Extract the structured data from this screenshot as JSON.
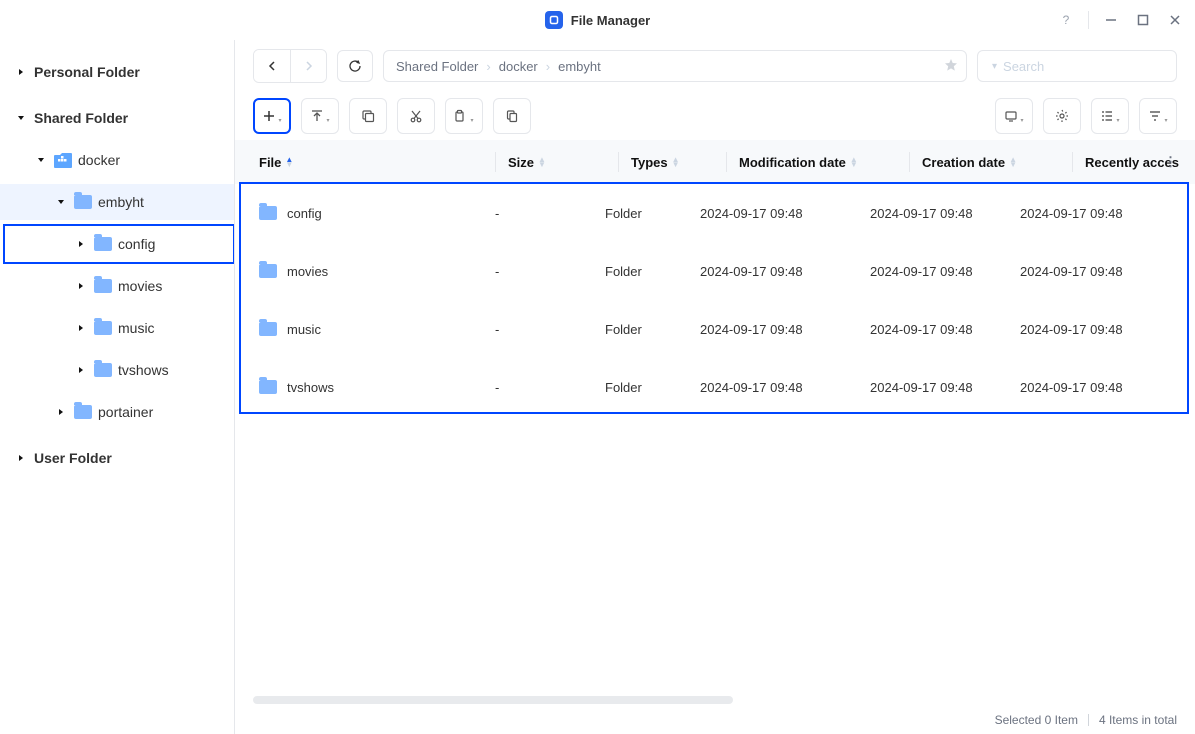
{
  "titlebar": {
    "title": "File Manager"
  },
  "sidebar": {
    "personal_label": "Personal Folder",
    "shared_label": "Shared Folder",
    "user_label": "User Folder",
    "docker_label": "docker",
    "embyht_label": "embyht",
    "config_label": "config",
    "movies_label": "movies",
    "music_label": "music",
    "tvshows_label": "tvshows",
    "portainer_label": "portainer"
  },
  "breadcrumb": {
    "root": "Shared Folder",
    "seg1": "docker",
    "seg2": "embyht"
  },
  "search": {
    "placeholder": "Search"
  },
  "table": {
    "headers": {
      "file": "File",
      "size": "Size",
      "types": "Types",
      "mod": "Modification date",
      "cre": "Creation date",
      "rec": "Recently acces"
    },
    "type_folder": "Folder",
    "size_dash": "-",
    "rows": [
      {
        "name": "config",
        "mod": "2024-09-17 09:48",
        "cre": "2024-09-17 09:48",
        "rec": "2024-09-17 09:48"
      },
      {
        "name": "movies",
        "mod": "2024-09-17 09:48",
        "cre": "2024-09-17 09:48",
        "rec": "2024-09-17 09:48"
      },
      {
        "name": "music",
        "mod": "2024-09-17 09:48",
        "cre": "2024-09-17 09:48",
        "rec": "2024-09-17 09:48"
      },
      {
        "name": "tvshows",
        "mod": "2024-09-17 09:48",
        "cre": "2024-09-17 09:48",
        "rec": "2024-09-17 09:48"
      }
    ]
  },
  "status": {
    "selected": "Selected 0 Item",
    "total": "4 Items in total"
  }
}
